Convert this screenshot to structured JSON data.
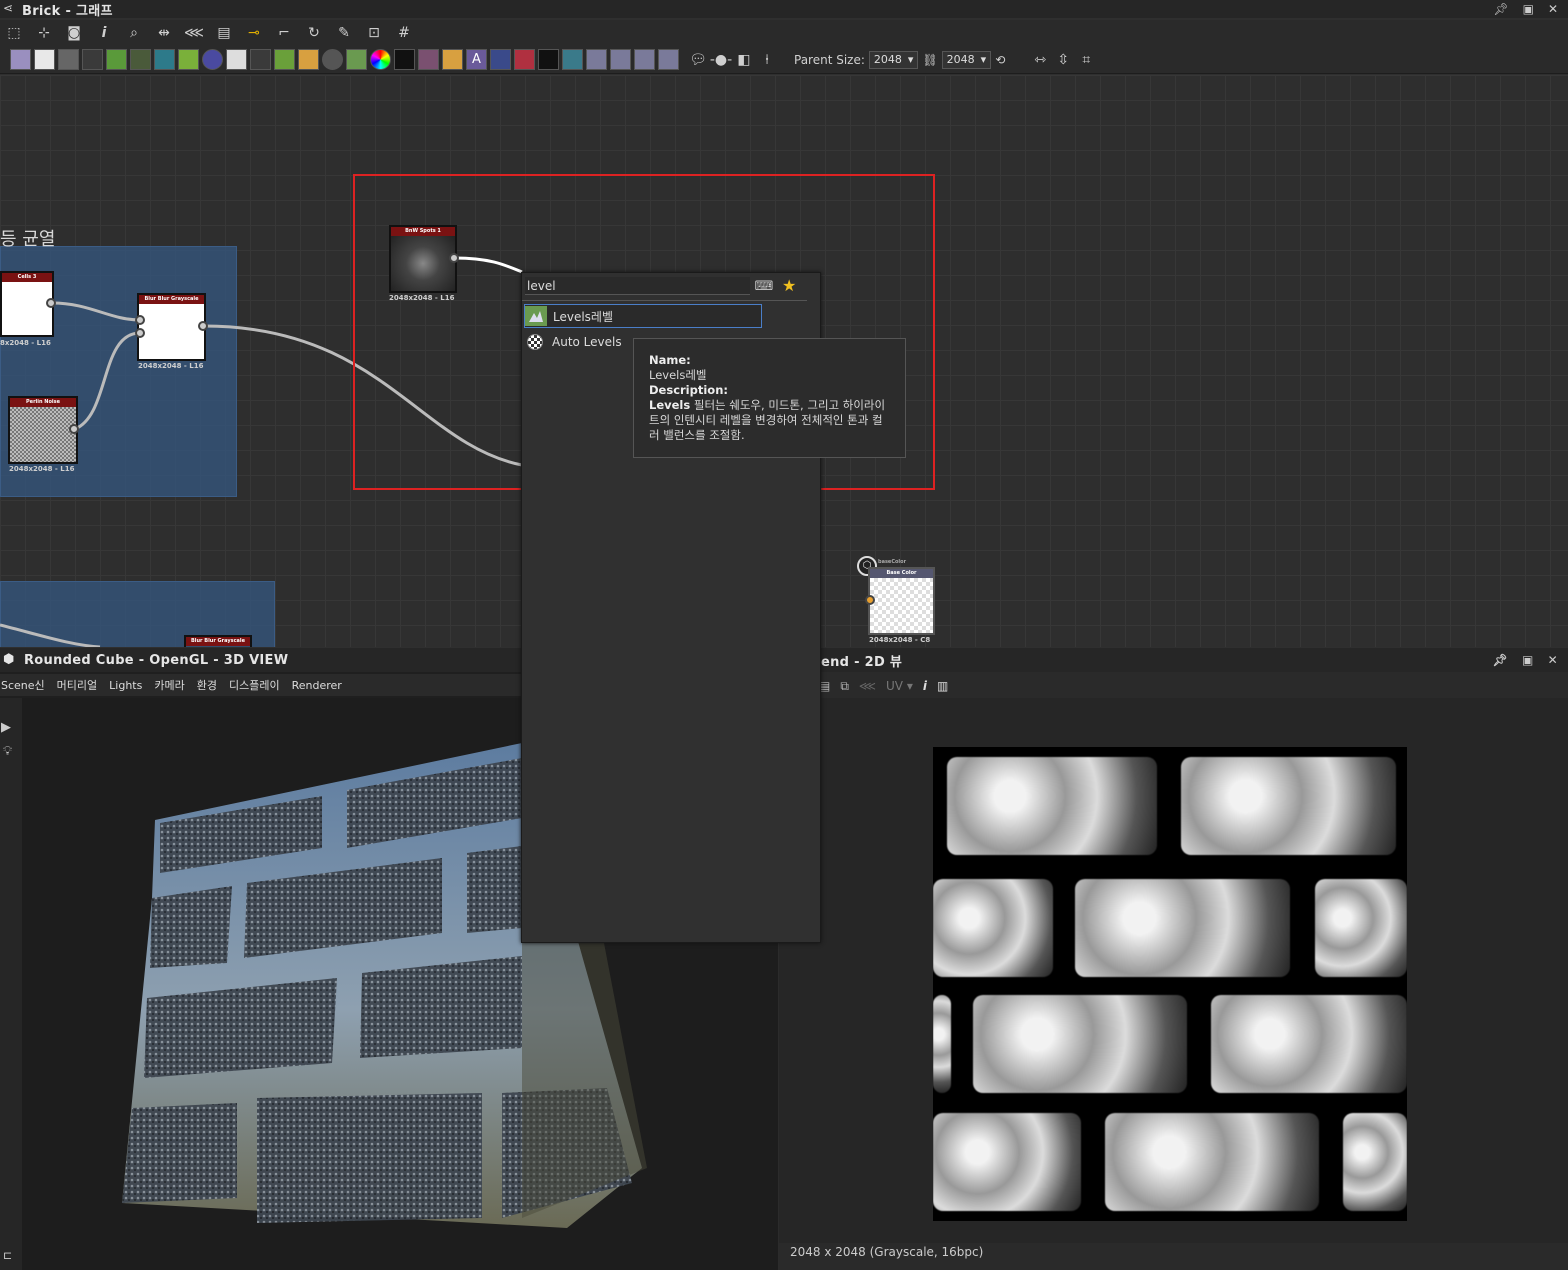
{
  "graph": {
    "title": "Brick - 그래프",
    "parent_size_label": "Parent Size:",
    "parent_size_value": "2048",
    "parent_size_value2": "2048",
    "frame_label": "등 균열"
  },
  "nodes": {
    "cells3": {
      "title": "Cells 3",
      "sub": "8x2048 - L16"
    },
    "blur1": {
      "title": "Blur Blur Grayscale",
      "sub": "2048x2048 - L16"
    },
    "perlin": {
      "title": "Perlin Noise",
      "sub": "2048x2048 - L16"
    },
    "bnw": {
      "title": "BnW Spots 1",
      "sub": "2048x2048 - L16"
    },
    "base": {
      "title": "Base Color",
      "sub": "2048x2048 - C8",
      "tag": "baseColor"
    },
    "blur2": {
      "title": "Blur Blur Grayscale"
    }
  },
  "popup": {
    "search_value": "level",
    "items": [
      {
        "label": "Levels레벨",
        "icon": "levels-icon"
      },
      {
        "label": "Auto Levels",
        "icon": "auto-levels-icon"
      }
    ]
  },
  "tooltip": {
    "name_label": "Name:",
    "name_value": "Levels레벨",
    "desc_label": "Description:",
    "desc_bold": "Levels",
    "desc_text": " 필터는 쉐도우, 미드톤, 그리고 하이라이트의 인텐시티 레벨을 변경하여 전체적인 톤과 컬러 밸런스를 조절함."
  },
  "view3d": {
    "title": "Rounded Cube - OpenGL - 3D VIEW",
    "menu": [
      "Scene신",
      "머티리얼",
      "Lights",
      "카메라",
      "환경",
      "디스플레이",
      "Renderer"
    ]
  },
  "view2d": {
    "title": "end - 2D 뷰",
    "uv_label": "UV",
    "status": "2048 x 2048 (Grayscale, 16bpc)"
  },
  "colors": {
    "highlight": "#dd2222",
    "frame": "#365882",
    "node_header": "#7a1212",
    "selection": "#4a7ec8",
    "star": "#f0c020"
  }
}
